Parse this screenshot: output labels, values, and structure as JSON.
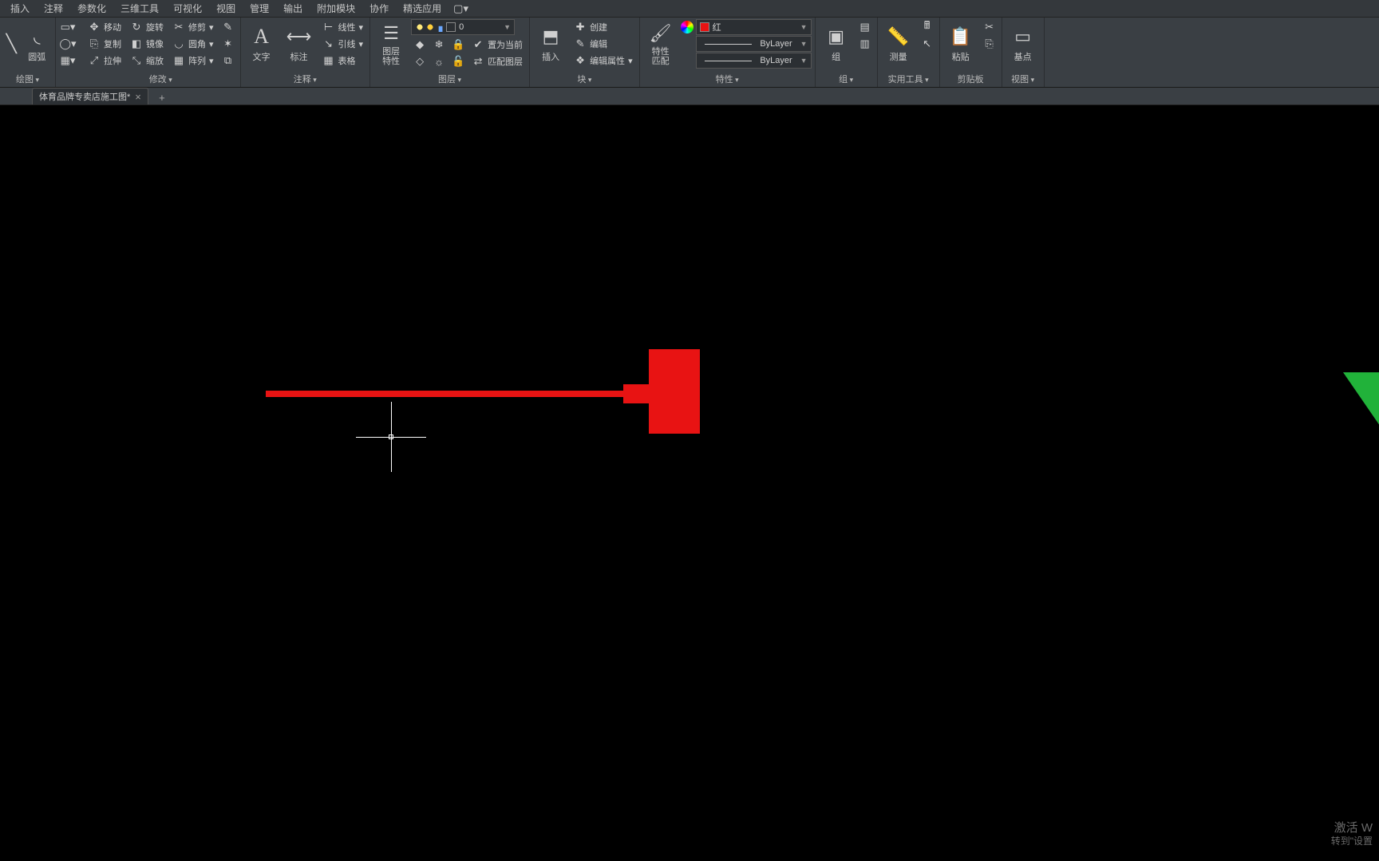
{
  "menu": [
    "插入",
    "注释",
    "参数化",
    "三维工具",
    "可视化",
    "视图",
    "管理",
    "输出",
    "附加模块",
    "协作",
    "精选应用"
  ],
  "ribbon": {
    "draw": {
      "title": "绘图",
      "arc": "圆弧"
    },
    "modify": {
      "title": "修改",
      "items": [
        [
          "移动",
          "旋转",
          "修剪"
        ],
        [
          "复制",
          "镜像",
          "圆角"
        ],
        [
          "拉伸",
          "缩放",
          "阵列"
        ]
      ]
    },
    "annot": {
      "title": "注释",
      "text": "文字",
      "dim": "标注",
      "items": [
        "线性",
        "引线",
        "表格"
      ]
    },
    "layer": {
      "title": "图层",
      "props": "图层\n特性",
      "current": "0",
      "items": [
        "置为当前",
        "匹配图层"
      ]
    },
    "block": {
      "title": "块",
      "insert": "插入",
      "items": [
        "创建",
        "编辑",
        "编辑属性"
      ]
    },
    "props": {
      "title": "特性",
      "match": "特性\n匹配",
      "color": "红",
      "bylayer1": "ByLayer",
      "bylayer2": "ByLayer"
    },
    "group": {
      "title": "组",
      "btn": "组"
    },
    "util": {
      "title": "实用工具",
      "btn": "测量"
    },
    "clip": {
      "title": "剪贴板",
      "btn": "粘贴"
    },
    "view": {
      "title": "视图",
      "btn": "基点"
    }
  },
  "tab": {
    "name": "体育品牌专卖店施工图*"
  },
  "watermark": {
    "line1": "激活 W",
    "line2": "转到\"设置"
  }
}
